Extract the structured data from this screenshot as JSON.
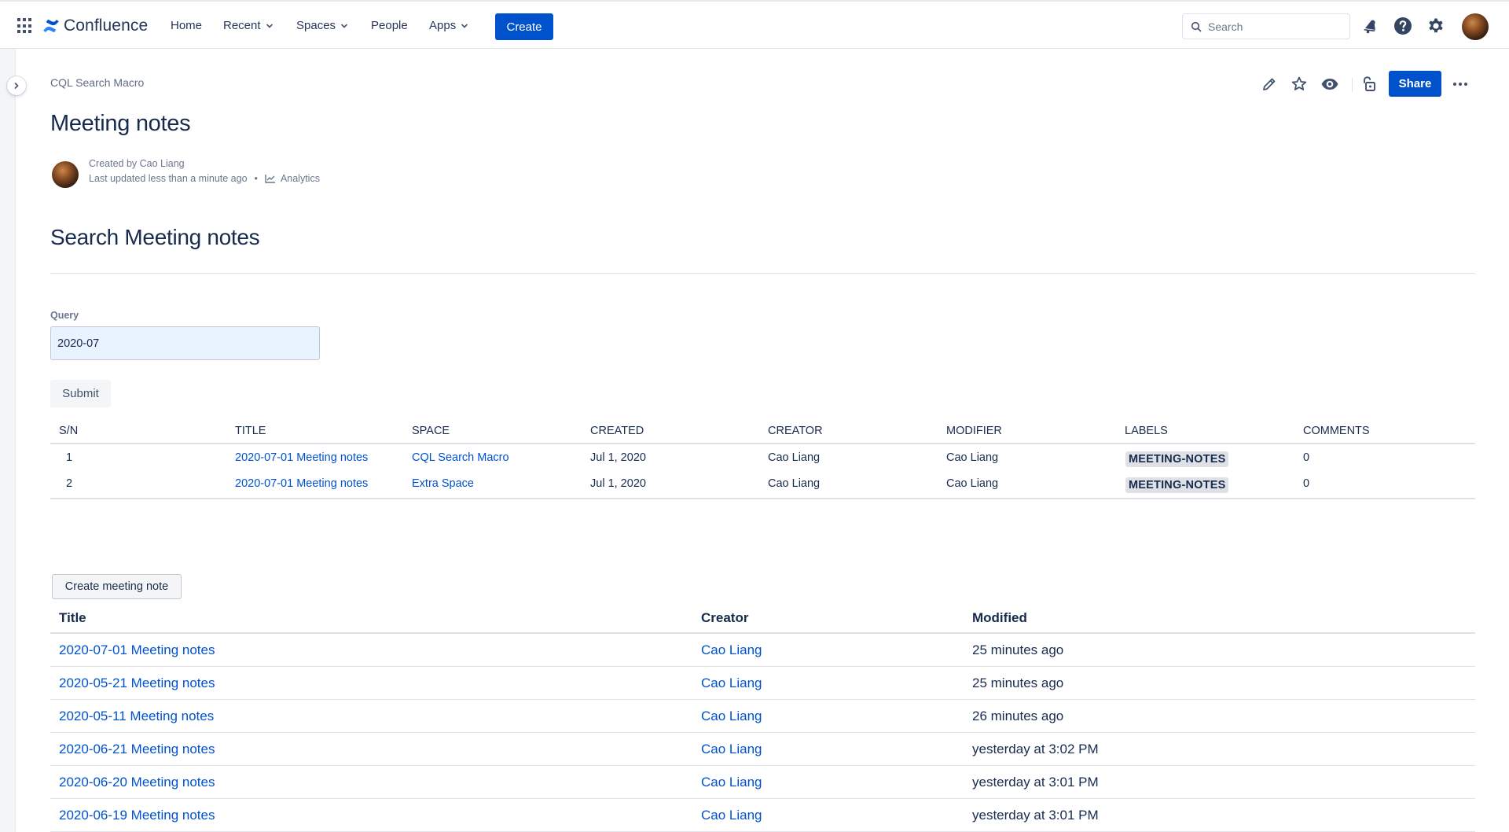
{
  "topnav": {
    "logo_text": "Confluence",
    "items": [
      {
        "label": "Home"
      },
      {
        "label": "Recent"
      },
      {
        "label": "Spaces"
      },
      {
        "label": "People"
      },
      {
        "label": "Apps"
      }
    ],
    "create_label": "Create",
    "search_placeholder": "Search"
  },
  "page": {
    "breadcrumb": "CQL Search Macro",
    "title": "Meeting notes",
    "created_by": "Created by Cao Liang",
    "last_updated": "Last updated less than a minute ago",
    "analytics_label": "Analytics",
    "share_label": "Share"
  },
  "search": {
    "heading": "Search Meeting notes",
    "query_label": "Query",
    "query_value": "2020-07",
    "submit_label": "Submit"
  },
  "cql_table": {
    "headers": [
      "S/N",
      "TITLE",
      "SPACE",
      "CREATED",
      "CREATOR",
      "MODIFIER",
      "LABELS",
      "COMMENTS"
    ],
    "rows": [
      {
        "sn": "1",
        "title": "2020-07-01 Meeting notes",
        "space": "CQL Search Macro",
        "created": "Jul 1, 2020",
        "creator": "Cao Liang",
        "modifier": "Cao Liang",
        "label": "MEETING-NOTES",
        "comments": "0"
      },
      {
        "sn": "2",
        "title": "2020-07-01 Meeting notes",
        "space": "Extra Space",
        "created": "Jul 1, 2020",
        "creator": "Cao Liang",
        "modifier": "Cao Liang",
        "label": "MEETING-NOTES",
        "comments": "0"
      }
    ]
  },
  "meeting_notes": {
    "create_label": "Create meeting note",
    "headers": [
      "Title",
      "Creator",
      "Modified"
    ],
    "rows": [
      {
        "title": "2020-07-01 Meeting notes",
        "creator": "Cao Liang",
        "modified": "25 minutes ago"
      },
      {
        "title": "2020-05-21 Meeting notes",
        "creator": "Cao Liang",
        "modified": "25 minutes ago"
      },
      {
        "title": "2020-05-11 Meeting notes",
        "creator": "Cao Liang",
        "modified": "26 minutes ago"
      },
      {
        "title": "2020-06-21 Meeting notes",
        "creator": "Cao Liang",
        "modified": "yesterday at 3:02 PM"
      },
      {
        "title": "2020-06-20 Meeting notes",
        "creator": "Cao Liang",
        "modified": "yesterday at 3:01 PM"
      },
      {
        "title": "2020-06-19 Meeting notes",
        "creator": "Cao Liang",
        "modified": "yesterday at 3:01 PM"
      }
    ]
  },
  "icons": {
    "apps": "app-switcher-icon",
    "logo": "confluence-logo-icon",
    "notifications": "notification-bell-icon",
    "help": "help-icon",
    "settings": "gear-icon",
    "edit": "pencil-icon",
    "star": "star-icon",
    "watch": "eye-icon",
    "restrictions": "unlock-icon",
    "more": "more-icon",
    "analytics": "chart-line-icon",
    "search": "search-icon",
    "sidebar_toggle": "chevron-right-icon"
  },
  "colors": {
    "brand": "#0052cc",
    "text": "#172b4d",
    "subtle": "#6b778c",
    "border": "#dfe1e6"
  }
}
